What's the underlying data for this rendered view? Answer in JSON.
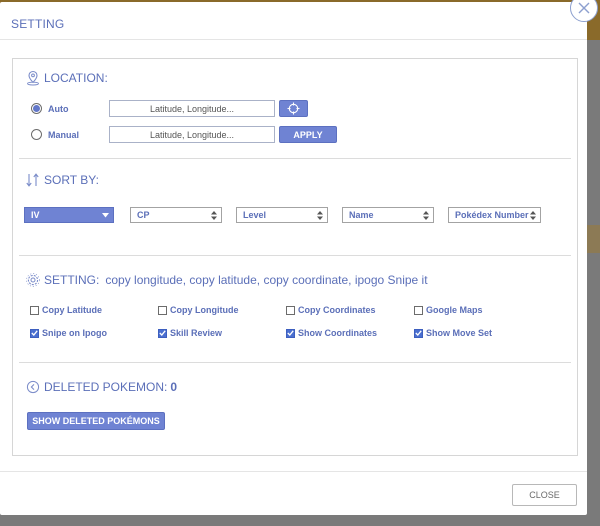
{
  "dialog": {
    "title": "SETTING"
  },
  "location": {
    "title": "LOCATION:",
    "auto": {
      "label": "Auto",
      "placeholder": "Latitude, Longitude...",
      "selected": true
    },
    "manual": {
      "label": "Manual",
      "placeholder": "Latitude, Longitude...",
      "selected": false
    },
    "apply_label": "APPLY"
  },
  "sort": {
    "title": "SORT BY:",
    "options": [
      {
        "label": "IV",
        "active": true
      },
      {
        "label": "CP",
        "active": false
      },
      {
        "label": "Level",
        "active": false
      },
      {
        "label": "Name",
        "active": false
      },
      {
        "label": "Pokédex Number",
        "active": false
      }
    ]
  },
  "settings": {
    "title": "SETTING:",
    "description": "copy longitude, copy latitude, copy coordinate, ipogo Snipe it",
    "checkboxes": [
      {
        "label": "Copy Latitude",
        "checked": false
      },
      {
        "label": "Copy Longitude",
        "checked": false
      },
      {
        "label": "Copy Coordinates",
        "checked": false
      },
      {
        "label": "Google Maps",
        "checked": false
      },
      {
        "label": "Snipe on Ipogo",
        "checked": true
      },
      {
        "label": "Skill Review",
        "checked": true
      },
      {
        "label": "Show Coordinates",
        "checked": true
      },
      {
        "label": "Show Move Set",
        "checked": true
      }
    ]
  },
  "deleted": {
    "title": "DELETED POKEMON:",
    "count": "0",
    "show_button": "SHOW DELETED POKÉMONS"
  },
  "footer": {
    "close_label": "CLOSE"
  },
  "colors": {
    "accent": "#6f83d3",
    "text": "#5b6fb8",
    "checkbox_checked": "#4a6fd0"
  }
}
